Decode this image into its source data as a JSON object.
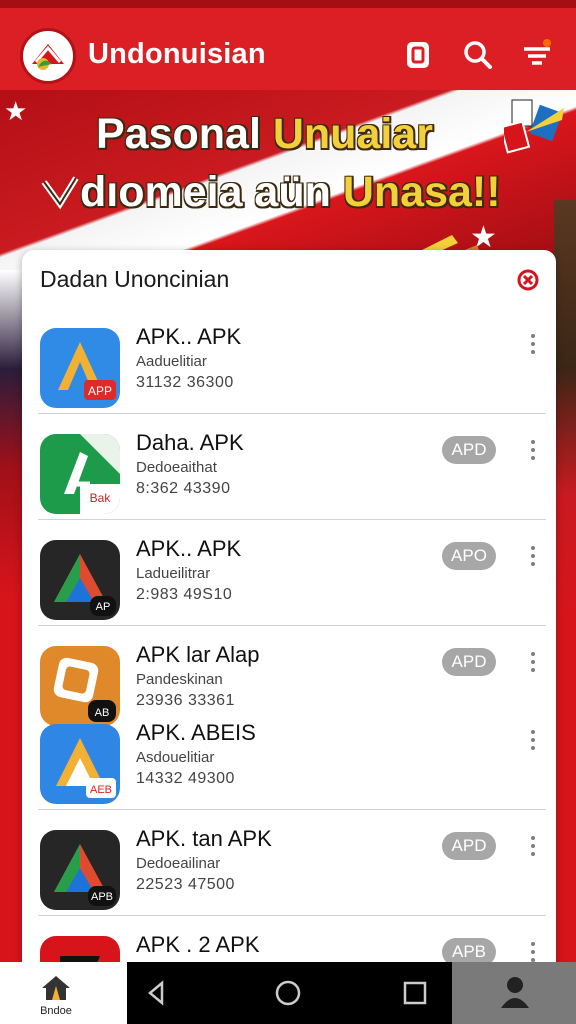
{
  "header": {
    "title": "Undonuisian",
    "icons": [
      "logo-icon",
      "document-icon",
      "search-icon",
      "filter-menu-icon"
    ]
  },
  "banner": {
    "line1_part1": "Pasonal ",
    "line1_part2": "Unuaiar",
    "line2_part1": "dıomeia aün ",
    "line2_part2": "Unasa!!"
  },
  "card": {
    "title": "Dadan Unoncinian",
    "close_icon": "close-icon"
  },
  "apps": [
    {
      "name": "APK.. APK",
      "subtitle": "Aaduelitiar",
      "size": "31132 36300",
      "badge": "",
      "icon_label": "APP",
      "colors": [
        "#2f8be6",
        "#f2b134"
      ]
    },
    {
      "name": "Daha. APK",
      "subtitle": "Dedoeaithat",
      "size": "8:362 43390",
      "badge": "APD",
      "icon_label": "Bak",
      "colors": [
        "#1e9a4b",
        "#ffffff"
      ]
    },
    {
      "name": "APK.. APK",
      "subtitle": "Ladueilitrar",
      "size": "2:983 49S10",
      "badge": "APO",
      "icon_label": "AP",
      "colors": [
        "#262626",
        "#e04b2f"
      ]
    },
    {
      "name": "APK lar Alap",
      "subtitle": "Pandeskinan",
      "size": "23936 33361",
      "badge": "APD",
      "icon_label": "AB",
      "colors": [
        "#e0892a",
        "#ffffff"
      ]
    },
    {
      "name": "APK. ABEIS",
      "subtitle": "Asdouelitiar",
      "size": "14332 49300",
      "badge": "",
      "icon_label": "AEB",
      "colors": [
        "#2f86e4",
        "#f2b134"
      ]
    },
    {
      "name": "APK. tan APK",
      "subtitle": "Dedoeailinar",
      "size": "22523 47500",
      "badge": "APD",
      "icon_label": "APB",
      "colors": [
        "#262626",
        "#e04b2f"
      ]
    },
    {
      "name": "APK . 2 APK",
      "subtitle": "",
      "size": "",
      "badge": "APB",
      "icon_label": "",
      "colors": [
        "#d8141b",
        "#f2b134"
      ]
    }
  ],
  "bottom_nav": {
    "home_label": "Bndoe",
    "items": [
      "home-icon",
      "back-icon",
      "home-circle-icon",
      "recents-icon",
      "profile-icon"
    ]
  }
}
